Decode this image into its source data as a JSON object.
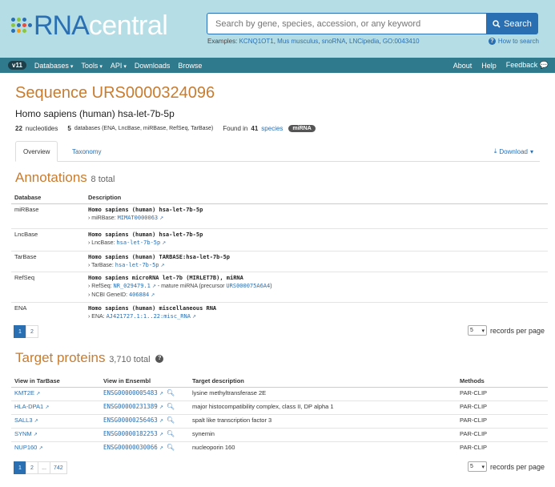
{
  "header": {
    "logo_prefix": "RNA",
    "logo_suffix": "central",
    "search_placeholder": "Search by gene, species, accession, or any keyword",
    "search_button": "Search",
    "examples_label": "Examples:",
    "examples": [
      "KCNQ1OT1",
      "Mus musculus",
      "snoRNA",
      "LNCipedia",
      "GO:0043410"
    ],
    "howto": "How to search"
  },
  "nav": {
    "version": "v11",
    "left": [
      "Databases",
      "Tools",
      "API",
      "Downloads",
      "Browse"
    ],
    "right": [
      "About",
      "Help",
      "Feedback"
    ]
  },
  "page": {
    "title": "Sequence URS0000324096",
    "subtitle": "Homo sapiens (human) hsa-let-7b-5p",
    "nucleotides_count": "22",
    "nucleotides_label": "nucleotides",
    "databases_count": "5",
    "databases_label": "databases (ENA, LncBase, miRBase, RefSeq, TarBase)",
    "found_in": "Found in",
    "species_count": "41",
    "species_label": "species",
    "rna_type_badge": "miRNA"
  },
  "tabs": {
    "overview": "Overview",
    "taxonomy": "Taxonomy",
    "download": "Download"
  },
  "annotations": {
    "title": "Annotations",
    "total": "8 total",
    "headers": [
      "Database",
      "Description"
    ],
    "rows": [
      {
        "db": "miRBase",
        "main": "Homo sapiens (human) hsa-let-7b-5p",
        "sub_prefix": "› miRBase:",
        "sub_link": "MIMAT0000063"
      },
      {
        "db": "LncBase",
        "main": "Homo sapiens (human) hsa-let-7b-5p",
        "sub_prefix": "› LncBase:",
        "sub_link": "hsa-let-7b-5p"
      },
      {
        "db": "TarBase",
        "main": "Homo sapiens (human) TARBASE:hsa-let-7b-5p",
        "sub_prefix": "› TarBase:",
        "sub_link": "hsa-let-7b-5p"
      },
      {
        "db": "RefSeq",
        "main": "Homo sapiens microRNA let-7b (MIRLET7B), miRNA",
        "sub_prefix": "› RefSeq:",
        "sub_link": "NR_029479.1",
        "sub_middle": "- mature miRNA (precursor",
        "sub_link2": "URS000075A6A4",
        "sub_end": ")",
        "sub2_prefix": "› NCBI GeneID:",
        "sub2_link": "406884"
      },
      {
        "db": "ENA",
        "main": "Homo sapiens (human) miscellaneous RNA",
        "sub_prefix": "› ENA:",
        "sub_link": "AJ421727.1:1..22:misc_RNA"
      }
    ],
    "pages": [
      "1",
      "2"
    ],
    "records_value": "5",
    "records_label": "records per page"
  },
  "targets": {
    "title": "Target proteins",
    "total": "3,710 total",
    "headers": [
      "View in TarBase",
      "View in Ensembl",
      "Target description",
      "Methods"
    ],
    "rows": [
      {
        "tarbase": "KMT2E",
        "ensembl": "ENSG00000005483",
        "desc": "lysine methyltransferase 2E",
        "method": "PAR-CLIP"
      },
      {
        "tarbase": "HLA-DPA1",
        "ensembl": "ENSG00000231389",
        "desc": "major histocompatibility complex, class II, DP alpha 1",
        "method": "PAR-CLIP"
      },
      {
        "tarbase": "SALL3",
        "ensembl": "ENSG00000256463",
        "desc": "spalt like transcription factor 3",
        "method": "PAR-CLIP"
      },
      {
        "tarbase": "SYNM",
        "ensembl": "ENSG00000182253",
        "desc": "synemin",
        "method": "PAR-CLIP"
      },
      {
        "tarbase": "NUP160",
        "ensembl": "ENSG00000030066",
        "desc": "nucleoporin 160",
        "method": "PAR-CLIP"
      }
    ],
    "pages": [
      "1",
      "2",
      "...",
      "742"
    ],
    "records_value": "5",
    "records_label": "records per page"
  },
  "colors": {
    "header_bg": "#b5dde5",
    "nav_bg": "#2f7a8c",
    "accent": "#2a6fb2",
    "title_orange": "#c97c2f"
  }
}
